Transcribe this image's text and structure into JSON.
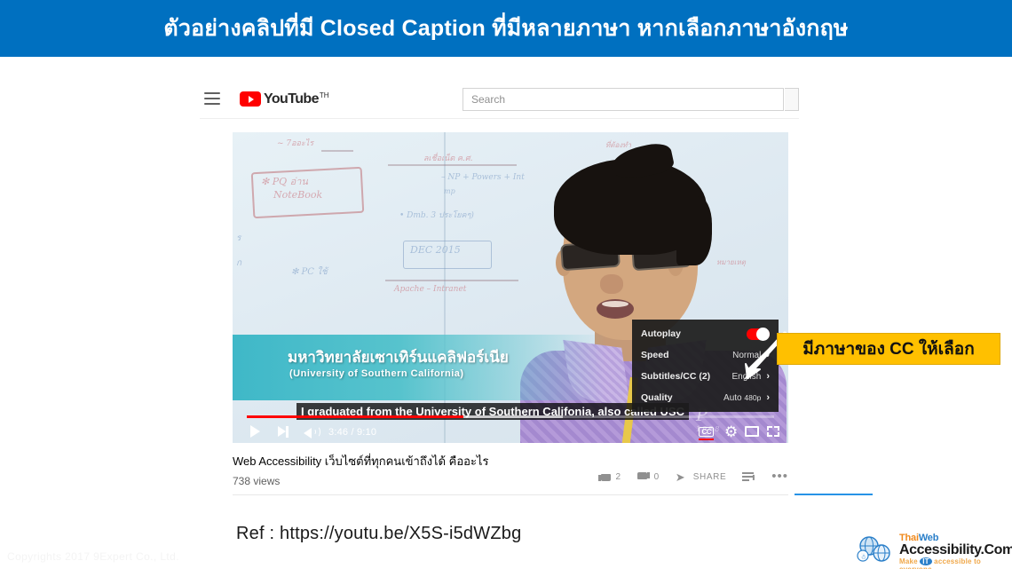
{
  "banner": {
    "title": "ตัวอย่างคลิปที่มี Closed  Caption ที่มีหลายภาษา หากเลือกภาษาอังกฤษ",
    "bg_color": "#0070c0",
    "text_color": "#ffffff"
  },
  "watermark": "Copyrights 2017 9Expert Co., Ltd.",
  "youtube": {
    "header": {
      "menu_icon": "hamburger-icon",
      "logo_text": "YouTube",
      "logo_superscript": "TH",
      "logo_color": "#ff0000",
      "search_placeholder": "Search",
      "search_value": "",
      "search_icon": "magnifier-icon"
    },
    "player": {
      "lower_third_thai": "มหาวิทยาลัยเซาเทิร์นแคลิฟอร์เนีย",
      "lower_third_english": "(University of Southern California)",
      "caption_text": "I graduated from the University of Southern Califonia, also called USC",
      "current_time": "3:46",
      "duration": "9:10",
      "time_display": "3:46 / 9:10",
      "progress_percent": 41,
      "buffered_percent": 60,
      "controls": {
        "play_icon": "play-icon",
        "next_icon": "next-video-icon",
        "volume_icon": "volume-icon",
        "cc_label": "CC",
        "cc_active": true,
        "settings_icon": "gear-icon",
        "theater_icon": "theater-mode-icon",
        "fullscreen_icon": "fullscreen-icon"
      }
    },
    "settings_menu": {
      "rows": [
        {
          "label": "Autoplay",
          "value": "",
          "type": "toggle",
          "toggle_on": true,
          "toggle_color": "#ff0000"
        },
        {
          "label": "Speed",
          "value": "Normal",
          "type": "submenu"
        },
        {
          "label": "Subtitles/CC (2)",
          "value": "English",
          "type": "submenu"
        },
        {
          "label": "Quality",
          "value": "Auto",
          "value_sub": "480p",
          "type": "submenu"
        }
      ],
      "arrow_glyph": "›"
    },
    "meta": {
      "title": "Web Accessibility เว็บไซต์ที่ทุกคนเข้าถึงได้ คืออะไร",
      "views": "738 views",
      "like_count": "2",
      "dislike_count": "0",
      "share_label": "SHARE",
      "save_icon": "save-to-playlist-icon",
      "more_icon": "more-options-icon",
      "like_icon": "thumbs-up-icon",
      "dislike_icon": "thumbs-down-icon",
      "share_icon": "share-arrow-icon"
    }
  },
  "callout": {
    "text": "มีภาษาของ  CC  ให้เลือก",
    "bg_color": "#ffc000",
    "text_color": "#111111",
    "arrow_icon": "pointer-arrow-icon"
  },
  "reference": {
    "text": "Ref : https://youtu.be/X5S-i5dWZbg"
  },
  "logo": {
    "line1_a": "Thai",
    "line1_b": "Web",
    "line2": "Accessibility.Com",
    "tagline_pre": "Make ",
    "tagline_it": "IT",
    "tagline_post": " accessible to everyone",
    "globe_icon": "globe-accessibility-icon"
  }
}
